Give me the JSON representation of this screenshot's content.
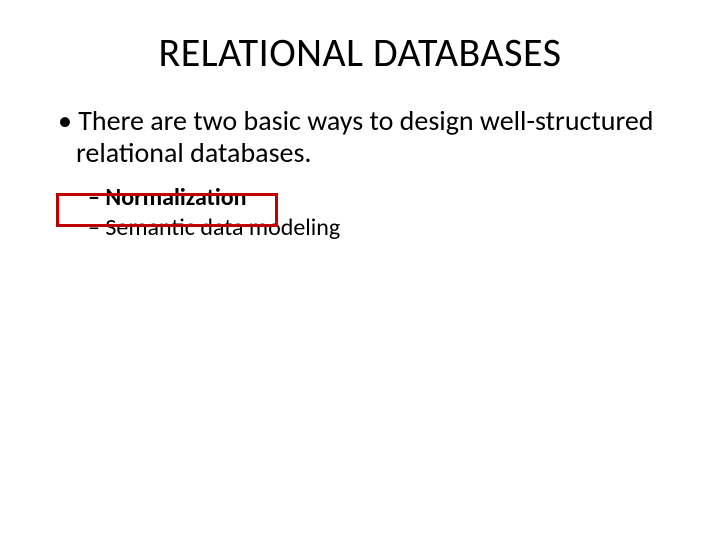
{
  "title": "RELATIONAL DATABASES",
  "bullet1": "There are two basic ways to design well-structured relational databases.",
  "sub1": "Normalization",
  "sub2": "Semantic data modeling"
}
